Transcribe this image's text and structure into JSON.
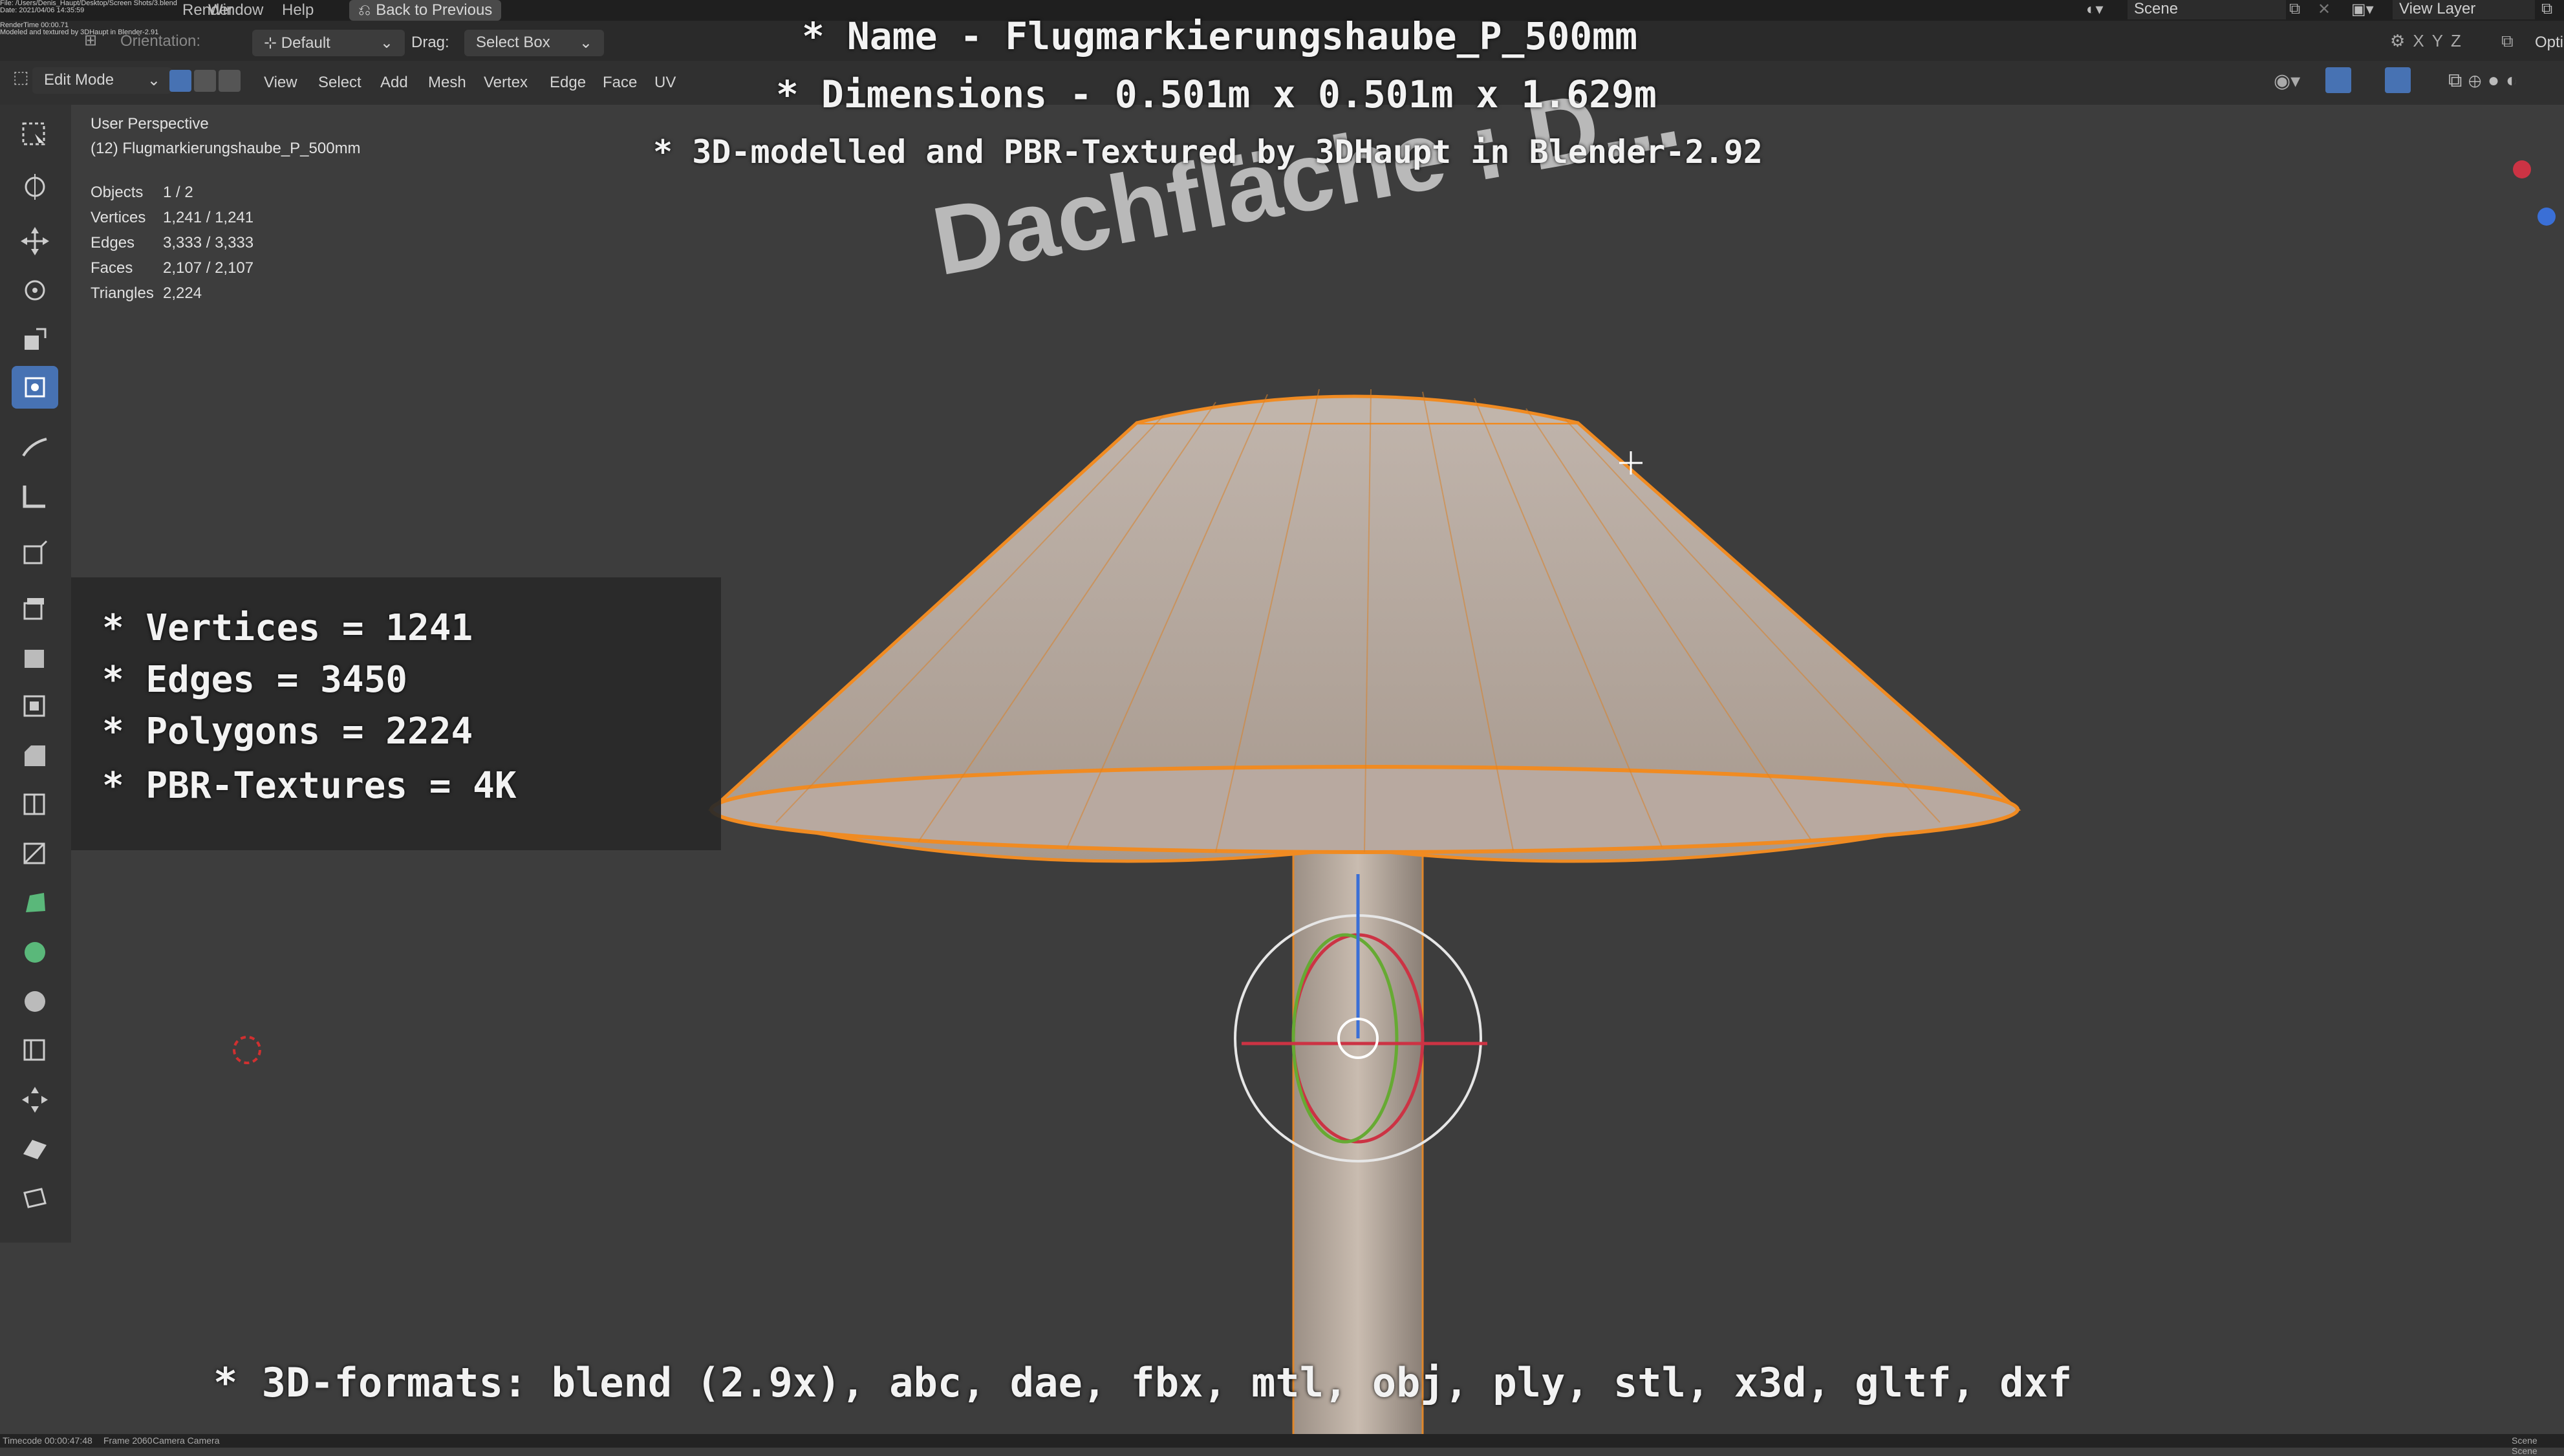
{
  "topbar": {
    "file_path_line1": "File: /Users/Denis_Haupt/Desktop/Screen Shots/3.blend",
    "date_line": "Date: 2021/04/06 14:35:59",
    "render_time_line": "RenderTime 00:00.71",
    "modeled_line": "Modeled and textured by 3DHaupt in Blender-2.91",
    "menu_help": "Help",
    "menu_window": "Window",
    "menu_render": "Render",
    "back_button": "Back to Previous",
    "scene_label": "Scene",
    "view_layer_label": "View Layer",
    "options_label": "Opti"
  },
  "header": {
    "orientation_label": "Orientation:",
    "orientation_value": "Default",
    "drag_label": "Drag:",
    "drag_value": "Select Box",
    "mode_value": "Edit Mode",
    "menus": [
      "View",
      "Select",
      "Add",
      "Mesh",
      "Vertex",
      "Edge",
      "Face",
      "UV"
    ]
  },
  "viewport": {
    "perspective": "User Perspective",
    "object_name": "(12) Flugmarkierungshaube_P_500mm",
    "stats": [
      {
        "label": "Objects",
        "value": "1 / 2"
      },
      {
        "label": "Vertices",
        "value": "1,241 / 1,241"
      },
      {
        "label": "Edges",
        "value": "3,333 / 3,333"
      },
      {
        "label": "Faces",
        "value": "2,107 / 2,107"
      },
      {
        "label": "Triangles",
        "value": "2,224"
      }
    ],
    "background_text": "Dachfläche : D..."
  },
  "overlay": {
    "name_line": "* Name - Flugmarkierungshaube_P_500mm",
    "dimensions_line": "* Dimensions -  0.501m x 0.501m x 1.629m",
    "credit_line": "* 3D-modelled and PBR-Textured by 3DHaupt in Blender-2.92",
    "info_lines": [
      "* Vertices = 1241",
      "* Edges = 3450",
      "* Polygons = 2224",
      "* PBR-Textures = 4K"
    ],
    "formats_line": "* 3D-formats: blend (2.9x), abc, dae, fbx, mtl, obj, ply, stl, x3d, gltf, dxf"
  },
  "statusbar": {
    "timecode": "Timecode 00:00:47:48",
    "frame": "Frame 2060",
    "camera": "Camera Camera",
    "right": "Scene Scene"
  },
  "colors": {
    "accent": "#4772b3",
    "selection": "#ff8a1a",
    "viewport_bg": "#3d3d3d"
  }
}
